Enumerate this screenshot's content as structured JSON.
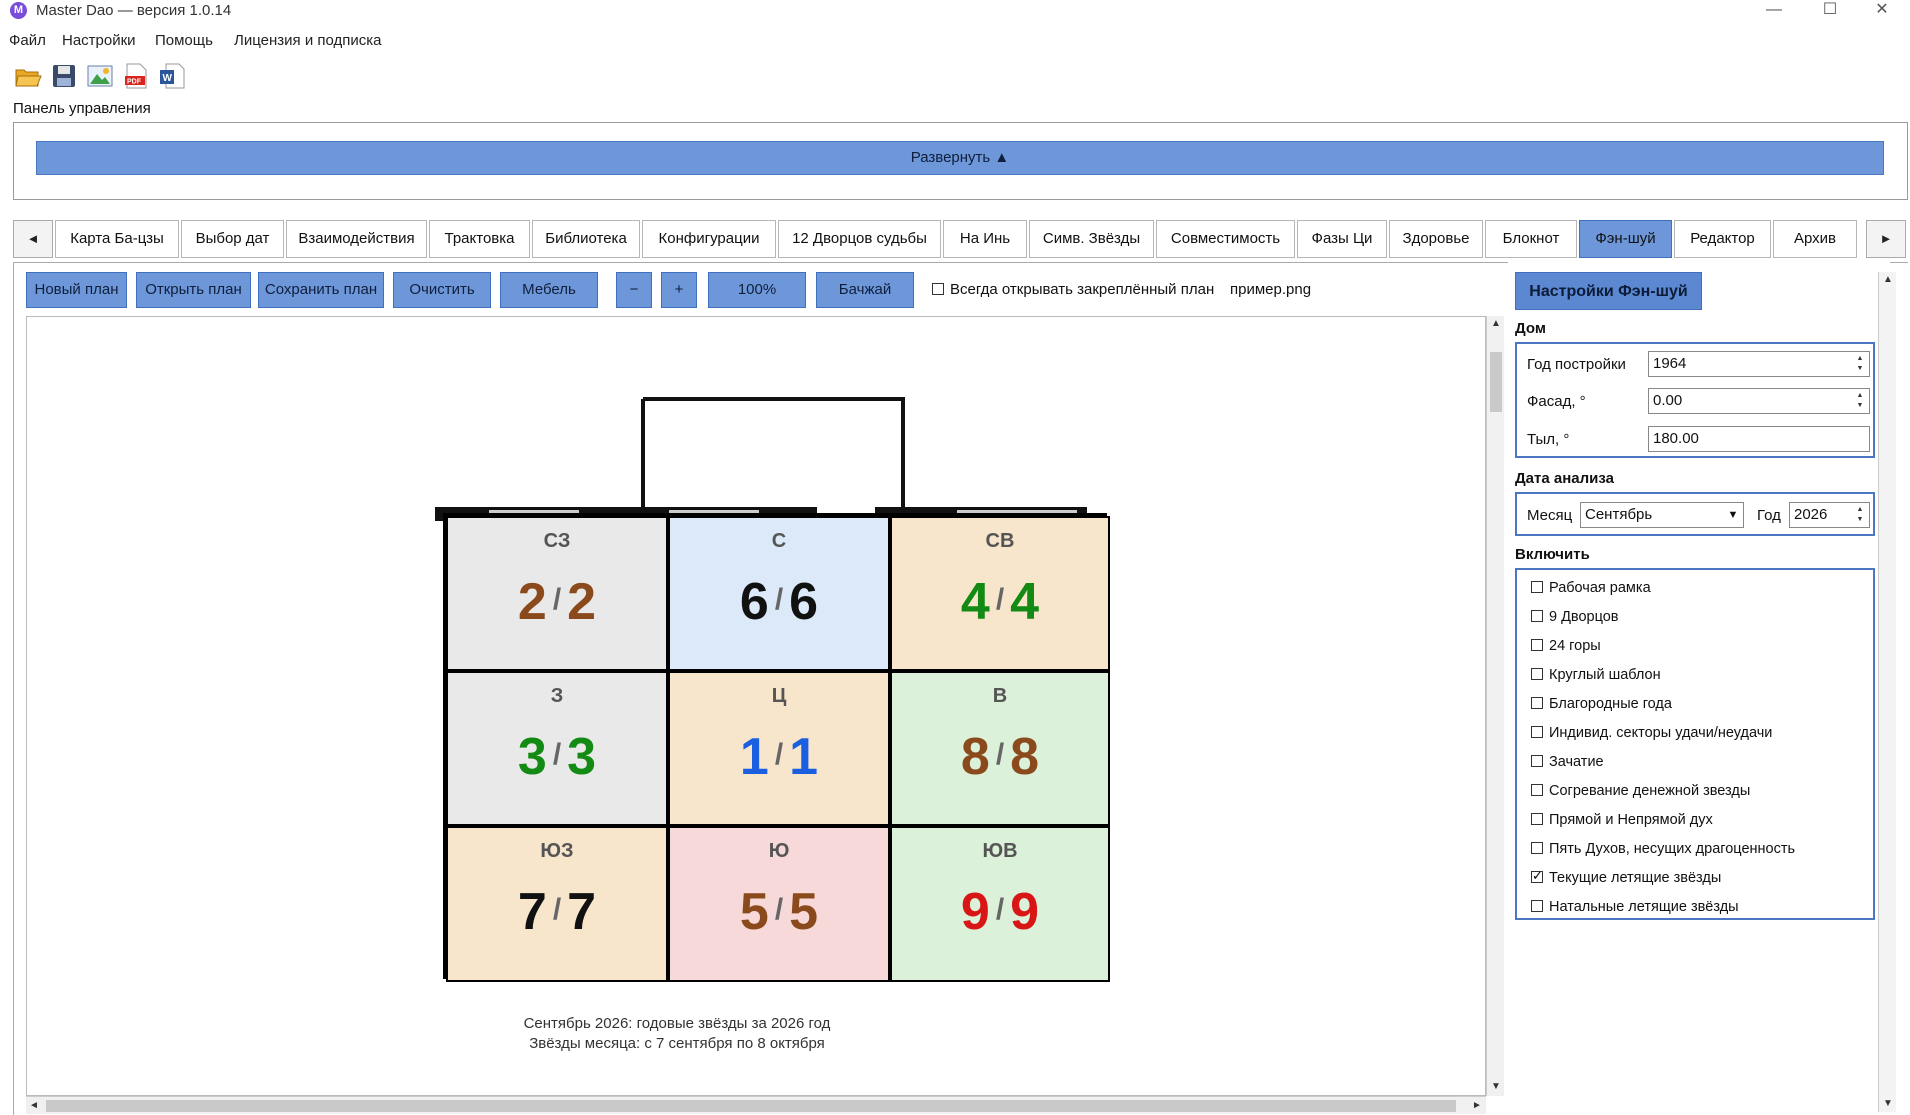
{
  "window": {
    "title": "Master Dao — версия 1.0.14",
    "icon_letter": "M",
    "minimize": "—",
    "maximize": "☐",
    "close": "✕"
  },
  "menu": [
    "Файл",
    "Настройки",
    "Помощь",
    "Лицензия и подписка"
  ],
  "toolbar_icons": [
    "folder-open-icon",
    "save-icon",
    "image-icon",
    "pdf-icon",
    "word-icon"
  ],
  "panel_label": "Панель управления",
  "expand_label": "Развернуть ▲",
  "tabs": {
    "left_arrow": "◄",
    "right_arrow": "►",
    "items": [
      "Карта Ба-цзы",
      "Выбор дат",
      "Взаимодействия",
      "Трактовка",
      "Библиотека",
      "Конфигурации",
      "12 Дворцов судьбы",
      "На Инь",
      "Симв. Звёзды",
      "Совместимость",
      "Фазы Ци",
      "Здоровье",
      "Блокнот",
      "Фэн-шуй",
      "Редактор",
      "Архив"
    ],
    "active": "Фэн-шуй"
  },
  "actions": {
    "new_plan": "Новый план",
    "open_plan": "Открыть план",
    "save_plan": "Сохранить план",
    "clear": "Очистить",
    "furniture": "Мебель",
    "zoom_out": "−",
    "zoom_in": "+",
    "zoom": "100%",
    "bagua": "Бачжай",
    "always_open_label": "Всегда открывать закреплённый план",
    "file_name": "пример.png"
  },
  "grid": [
    {
      "dir": "СЗ",
      "a": "2",
      "b": "2",
      "color": "#8b4a1c",
      "bg": "#e9e9e9"
    },
    {
      "dir": "С",
      "a": "6",
      "b": "6",
      "color": "#111111",
      "bg": "#dbe9f8"
    },
    {
      "dir": "СВ",
      "a": "4",
      "b": "4",
      "color": "#138a13",
      "bg": "#f7e6cc"
    },
    {
      "dir": "З",
      "a": "3",
      "b": "3",
      "color": "#138a13",
      "bg": "#e9e9e9"
    },
    {
      "dir": "Ц",
      "a": "1",
      "b": "1",
      "color": "#1a5fe0",
      "bg": "#f7e6cc"
    },
    {
      "dir": "В",
      "a": "8",
      "b": "8",
      "color": "#8b4a1c",
      "bg": "#dcf1d9"
    },
    {
      "dir": "ЮЗ",
      "a": "7",
      "b": "7",
      "color": "#111111",
      "bg": "#f7e6cc"
    },
    {
      "dir": "Ю",
      "a": "5",
      "b": "5",
      "color": "#8b4a1c",
      "bg": "#f8d9d9"
    },
    {
      "dir": "ЮВ",
      "a": "9",
      "b": "9",
      "color": "#d81616",
      "bg": "#dcf1d9"
    }
  ],
  "separator": "/",
  "caption_line1": "Сентябрь 2026: годовые звёзды за 2026 год",
  "caption_line2": "Звёзды месяца: с 7 сентября по 8 октября",
  "settings": {
    "title": "Настройки Фэн-шуй",
    "house_section": "Дом",
    "year_label": "Год постройки",
    "year_value": "1964",
    "facade_label": "Фасад, °",
    "facade_value": "0.00",
    "back_label": "Тыл, °",
    "back_value": "180.00",
    "date_section": "Дата анализа",
    "month_label": "Месяц",
    "month_value": "Сентябрь",
    "year2_label": "Год",
    "year2_value": "2026",
    "include_section": "Включить",
    "options": [
      {
        "label": "Рабочая рамка",
        "checked": false
      },
      {
        "label": "9 Дворцов",
        "checked": false
      },
      {
        "label": "24 горы",
        "checked": false
      },
      {
        "label": "Круглый шаблон",
        "checked": false
      },
      {
        "label": "Благородные года",
        "checked": false
      },
      {
        "label": "Индивид. секторы удачи/неудачи",
        "checked": false
      },
      {
        "label": "Зачатие",
        "checked": false
      },
      {
        "label": "Согревание денежной звезды",
        "checked": false
      },
      {
        "label": "Прямой и Непрямой дух",
        "checked": false
      },
      {
        "label": "Пять Духов, несущих драгоценность",
        "checked": false
      },
      {
        "label": "Текущие летящие звёзды",
        "checked": true
      },
      {
        "label": "Натальные летящие звёзды",
        "checked": false
      }
    ]
  }
}
